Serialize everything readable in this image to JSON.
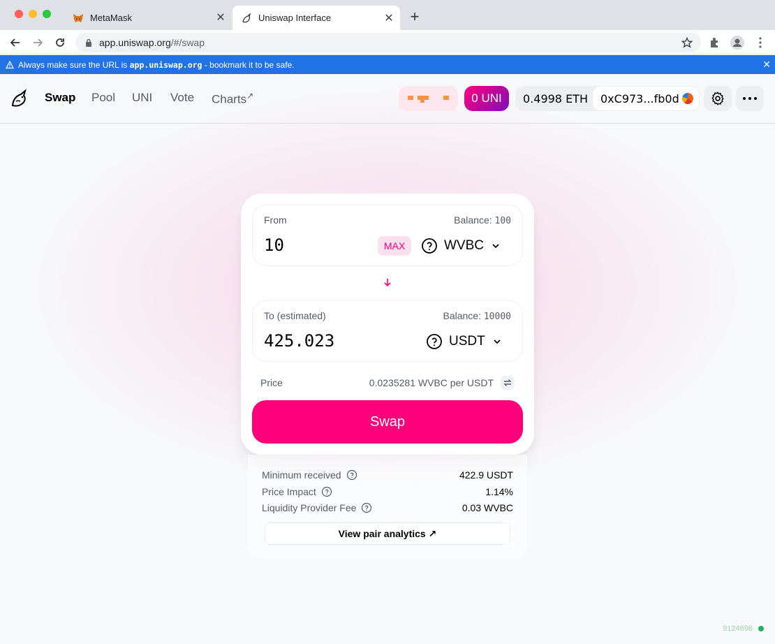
{
  "browser": {
    "tabs": [
      {
        "title": "MetaMask",
        "icon": "metamask-fox-icon",
        "active": false
      },
      {
        "title": "Uniswap Interface",
        "icon": "uniswap-unicorn-icon",
        "active": true
      }
    ],
    "url": {
      "host": "app.uniswap.org",
      "path": "/#/swap"
    }
  },
  "banner": {
    "prefix": "Always make sure the URL is",
    "domain": "app.uniswap.org",
    "suffix": "- bookmark it to be safe.",
    "color": "#2172e5"
  },
  "header": {
    "nav": [
      {
        "label": "Swap",
        "active": true
      },
      {
        "label": "Pool",
        "active": false
      },
      {
        "label": "UNI",
        "active": false
      },
      {
        "label": "Vote",
        "active": false
      },
      {
        "label": "Charts",
        "suffix": "↗",
        "active": false
      }
    ],
    "uni_balance": "0 UNI",
    "eth_balance": "0.4998 ETH",
    "address": "0xC973...fb0d"
  },
  "swap": {
    "from": {
      "label": "From",
      "balance_label": "Balance:",
      "balance": "100",
      "amount": "10",
      "token": "WVBC",
      "max_label": "MAX"
    },
    "to": {
      "label": "To (estimated)",
      "balance_label": "Balance:",
      "balance": "10000",
      "amount": "425.023",
      "token": "USDT"
    },
    "price_label": "Price",
    "price_value": "0.0235281 WVBC per USDT",
    "button_label": "Swap"
  },
  "details": {
    "rows": [
      {
        "label": "Minimum received",
        "value": "422.9 USDT"
      },
      {
        "label": "Price Impact",
        "value": "1.14%"
      },
      {
        "label": "Liquidity Provider Fee",
        "value": "0.03 WVBC"
      }
    ],
    "analytics_label": "View pair analytics ↗"
  },
  "block_number": "9124696",
  "colors": {
    "accent": "#ff007a",
    "text_secondary": "#565a69"
  }
}
